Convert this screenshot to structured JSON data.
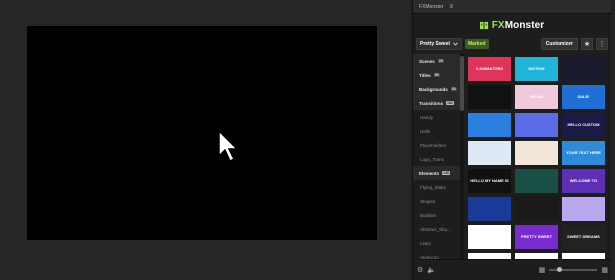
{
  "panel": {
    "tab_label": "FXMonster",
    "tab_menu": "≡"
  },
  "brand": {
    "prefix": "FX",
    "name": "Monster",
    "accent_color": "#9be34a"
  },
  "toolbar": {
    "pack_selected": "Pretty Sweet",
    "status_badge": "Marked",
    "customize_label": "Customizer",
    "favorites_icon": "star-icon",
    "more_icon": "more-icon"
  },
  "sidebar": {
    "items": [
      {
        "label": "Scenes",
        "count": "26",
        "kind": "category"
      },
      {
        "label": "Titles",
        "count": "86",
        "kind": "category"
      },
      {
        "label": "Backgrounds",
        "count": "84",
        "kind": "category"
      },
      {
        "label": "Transitions",
        "count": "182",
        "kind": "category"
      },
      {
        "label": "Handy",
        "count": "",
        "kind": "sub"
      },
      {
        "label": "Halfs",
        "count": "",
        "kind": "sub"
      },
      {
        "label": "Placeholders",
        "count": "",
        "kind": "sub"
      },
      {
        "label": "Logo_Trans",
        "count": "",
        "kind": "sub"
      },
      {
        "label": "Elements",
        "count": "149",
        "kind": "category"
      },
      {
        "label": "Flying_Slabs",
        "count": "",
        "kind": "sub"
      },
      {
        "label": "Shapes",
        "count": "",
        "kind": "sub"
      },
      {
        "label": "Bubbles",
        "count": "",
        "kind": "sub"
      },
      {
        "label": "Abstract_Sha...",
        "count": "",
        "kind": "sub"
      },
      {
        "label": "Lines",
        "count": "",
        "kind": "sub"
      },
      {
        "label": "Atomicon",
        "count": "",
        "kind": "sub"
      }
    ]
  },
  "grid": {
    "thumbs": [
      {
        "label": "// ANIMATORS",
        "bg": "#e0345a",
        "fg": "#fff"
      },
      {
        "label": "MOTION",
        "bg": "#1fb4d8",
        "fg": "#fff"
      },
      {
        "label": "",
        "bg": "#1a1a2e",
        "fg": "#fff"
      },
      {
        "label": "",
        "bg": "#111",
        "fg": "#fff"
      },
      {
        "label": "HELLO",
        "bg": "#f1c9dc",
        "fg": "#fff"
      },
      {
        "label": "SALE!",
        "bg": "#1f6fd6",
        "fg": "#fff"
      },
      {
        "label": "",
        "bg": "#2a7fe0",
        "fg": "#fff"
      },
      {
        "label": "",
        "bg": "#5b6ce8",
        "fg": "#fff"
      },
      {
        "label": "HELLO CUSTOM",
        "bg": "#1b1b4a",
        "fg": "#fff"
      },
      {
        "label": "",
        "bg": "#dfe9f5",
        "fg": "#333"
      },
      {
        "label": "",
        "bg": "#f3e7dc",
        "fg": "#333"
      },
      {
        "label": "YOUR TEXT HERE",
        "bg": "#2f8ad9",
        "fg": "#fff"
      },
      {
        "label": "HELLO MY NAME IS",
        "bg": "#111",
        "fg": "#fff"
      },
      {
        "label": "",
        "bg": "#1a4f45",
        "fg": "#fff"
      },
      {
        "label": "WELCOME TO",
        "bg": "#5d2fb5",
        "fg": "#fff"
      },
      {
        "label": "",
        "bg": "#1a3a9a",
        "fg": "#fff"
      },
      {
        "label": "",
        "bg": "#1a1a1a",
        "fg": "#fff"
      },
      {
        "label": "",
        "bg": "#b9a8ef",
        "fg": "#fff"
      },
      {
        "label": "",
        "bg": "#ffffff",
        "fg": "#333"
      },
      {
        "label": "PRETTY SWEET",
        "bg": "#7a2bd0",
        "fg": "#fff"
      },
      {
        "label": "SWEET DREAMS",
        "bg": "#222",
        "fg": "#fff"
      },
      {
        "label": "",
        "bg": "#ffffff",
        "fg": "#333"
      },
      {
        "label": "",
        "bg": "#ffffff",
        "fg": "#333"
      },
      {
        "label": "",
        "bg": "#ffffff",
        "fg": "#333"
      }
    ]
  }
}
